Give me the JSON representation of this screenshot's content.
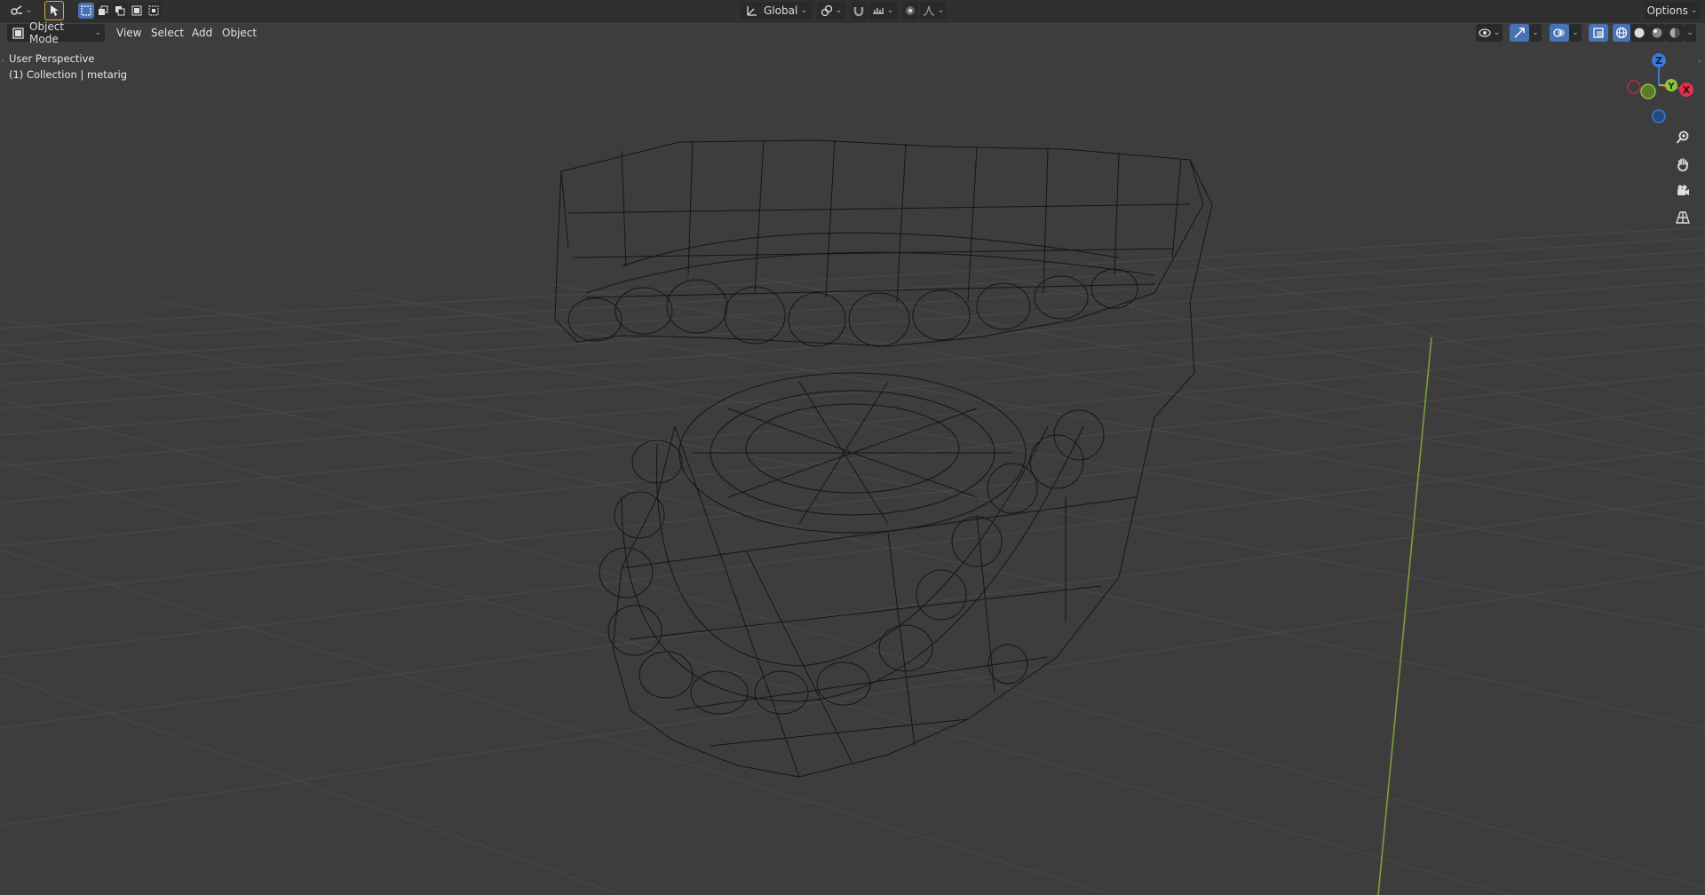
{
  "topbar": {
    "orientation": "Global",
    "options_label": "Options"
  },
  "header": {
    "mode": "Object Mode",
    "menus": [
      "View",
      "Select",
      "Add",
      "Object"
    ]
  },
  "viewport_info": {
    "perspective": "User Perspective",
    "collection": "(1) Collection | metarig"
  },
  "gizmo": {
    "x_label": "X",
    "y_label": "Y",
    "z_label": "Z"
  },
  "colors": {
    "background": "#3d3d3d",
    "x_axis": "#e0334a",
    "y_axis": "#8fc53c",
    "z_axis": "#3a7ad4",
    "active": "#4772b3",
    "wire": "#111111"
  }
}
